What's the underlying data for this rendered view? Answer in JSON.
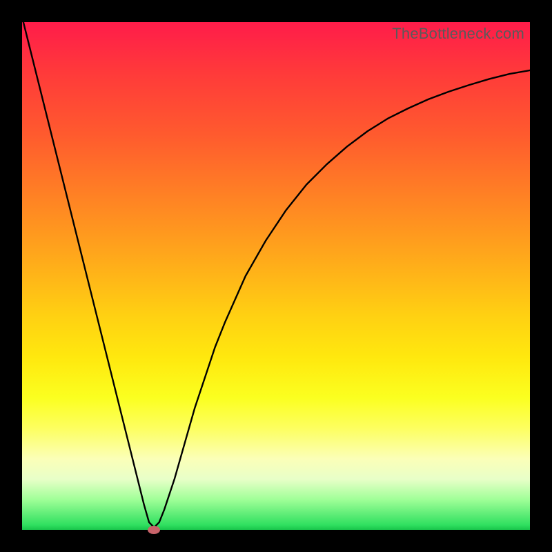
{
  "watermark": "TheBottleneck.com",
  "chart_data": {
    "type": "line",
    "title": "",
    "xlabel": "",
    "ylabel": "",
    "xlim": [
      0,
      100
    ],
    "ylim": [
      0,
      100
    ],
    "x": [
      0,
      4,
      8,
      12,
      16,
      20,
      22,
      24,
      25,
      26,
      27,
      28,
      30,
      32,
      34,
      36,
      38,
      40,
      44,
      48,
      52,
      56,
      60,
      64,
      68,
      72,
      76,
      80,
      84,
      88,
      92,
      96,
      100
    ],
    "values": [
      101,
      85,
      69,
      53,
      37,
      21,
      13,
      5,
      1.5,
      0.5,
      1.5,
      4,
      10,
      17,
      24,
      30,
      36,
      41,
      50,
      57,
      63,
      68,
      72,
      75.5,
      78.5,
      81,
      83,
      84.8,
      86.3,
      87.6,
      88.8,
      89.8,
      90.5
    ],
    "series": [
      {
        "name": "curve",
        "x": "shared",
        "values": "shared"
      }
    ],
    "point_of_interest": {
      "x": 26,
      "y": 0
    },
    "background_gradient": {
      "top": "#ff1c4a",
      "mid": "#ffd112",
      "bottom": "#18c44a"
    },
    "colors": {
      "curve": "#000000",
      "poi": "#c8636a",
      "frame": "#000000"
    }
  }
}
